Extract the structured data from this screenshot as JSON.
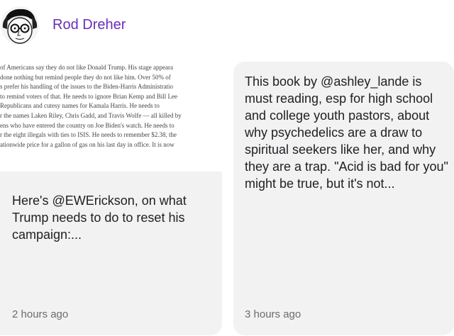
{
  "author": {
    "name": "Rod Dreher",
    "avatar_icon": "caricature-avatar-icon",
    "name_color": "#6a2db8"
  },
  "posts": [
    {
      "image_excerpt_lines": [
        "of Americans say they do not like Donald Trump. His stage appeara",
        "done nothing but remind people they do not like him. Over 50% of",
        "s prefer his handling of the issues to the Biden-Harris Administratio",
        "to remind voters of that. He needs to ignore Brian Kemp and Bill Lee",
        "Republicans and cutesy names for Kamala Harris. He needs to",
        "r the names Laken Riley, Chris Gadd, and Travis Wolfe — all killed by",
        "ens who have entered the country on Joe Biden's watch. He needs to",
        "r the eight illegals with ties to ISIS. He needs to remember $2.38, the",
        "ationwide price for a gallon of gas on his last day in office. It is now"
      ],
      "text": "Here's @EWErickson, on what Trump needs to do to reset his campaign:...",
      "time": "2 hours ago"
    },
    {
      "text": "This book by @ashley_lande is must reading, esp for high school and college youth pastors, about why psychedelics are a draw to spiritual seekers like her, and why they are a trap. \"Acid is bad for you\" might be true, but it's not...",
      "time": "3 hours ago"
    }
  ]
}
